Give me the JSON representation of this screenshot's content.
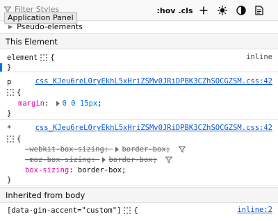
{
  "toolbar": {
    "filter_placeholder": "Filter Styles",
    "hov_label": ":hov",
    "cls_label": ".cls",
    "tooltip": "Application Panel",
    "icons": [
      "filter-icon",
      "plus-icon",
      "sun-icon",
      "contrast-icon",
      "print-icon"
    ]
  },
  "pseudo": {
    "label": "Pseudo-elements"
  },
  "this_element": {
    "header": "This Element",
    "selector": "element",
    "brace_open": "{",
    "brace_close": "}",
    "source": "inline"
  },
  "rule_p": {
    "selector": "p",
    "source": "css_KJeu6reL0ryEkhL5xHriZSMv0JRiDPBK3CZhSOCGZSM.css:42",
    "brace_open": "{",
    "brace_close": "}",
    "declarations": [
      {
        "prop": "margin",
        "value": "0 0 15px",
        "overridden": false
      }
    ]
  },
  "rule_star": {
    "selector": "*",
    "source": "css_KJeu6reL0ryEkhL5xHriZSMv0JRiDPBK3CZhSOCGZSM.css:42",
    "brace_open": "{",
    "brace_close": "}",
    "declarations": [
      {
        "prop": "-webkit-box-sizing",
        "value": "border-box",
        "overridden": true
      },
      {
        "prop": "-moz-box-sizing",
        "value": "border-box",
        "overridden": true
      },
      {
        "prop": "box-sizing",
        "value": "border-box",
        "overridden": false
      }
    ]
  },
  "inherited": {
    "header": "Inherited from body",
    "selector": "[data-gin-accent=\"custom\"]",
    "brace_open": "{",
    "source": "inline:2"
  },
  "colors": {
    "property": "#dd00a9",
    "link": "#0b56d4",
    "accent": "#0074e8"
  }
}
